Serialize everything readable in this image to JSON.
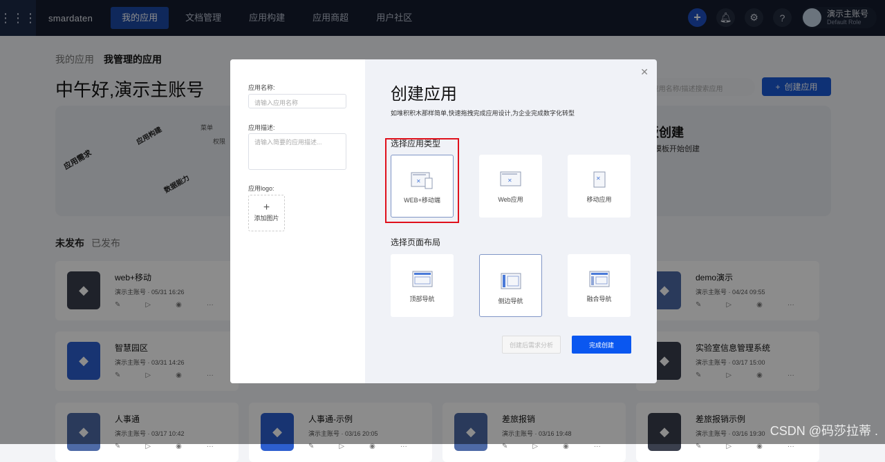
{
  "topbar": {
    "logo": "smardaten",
    "nav": [
      "我的应用",
      "文档管理",
      "应用构建",
      "应用商超",
      "用户社区"
    ],
    "user_name": "演示主账号",
    "user_role": "Default Role"
  },
  "page": {
    "tabs": [
      "我的应用",
      "我管理的应用"
    ],
    "greeting": "中午好,演示主账号",
    "search_placeholder": "入/应用名称/描述搜索应用",
    "create_button": "创建应用",
    "banner_title": "板创建",
    "banner_sub": "有模板开始创建",
    "banner_labels": [
      "应用需求",
      "应用构建",
      "数据能力",
      "菜单",
      "权限"
    ],
    "status_tabs": [
      "未发布",
      "已发布"
    ]
  },
  "cards": [
    {
      "title": "web+移动",
      "owner": "演示主账号",
      "time": "05/31 16:26",
      "color": "#3a3f4d"
    },
    {
      "title": "demo演示",
      "owner": "演示主账号",
      "time": "04/24 09:55",
      "color": "#4e6aa6"
    },
    {
      "title": "智慧园区",
      "owner": "演示主账号",
      "time": "03/31 14:26",
      "color": "#2d5fcf"
    },
    {
      "title": "实验室信息管理系统",
      "owner": "演示主账号",
      "time": "03/17 15:00",
      "color": "#3a3f4d"
    },
    {
      "title": "人事通",
      "owner": "演示主账号",
      "time": "03/17 10:42",
      "color": "#4e6aa6"
    },
    {
      "title": "人事通-示例",
      "owner": "演示主账号",
      "time": "03/16 20:05",
      "color": "#2d5fcf"
    },
    {
      "title": "差旅报销",
      "owner": "演示主账号",
      "time": "03/16 19:48",
      "color": "#4e6aa6"
    },
    {
      "title": "差旅报销示例",
      "owner": "演示主账号",
      "time": "03/16 19:30",
      "color": "#3a3f4d"
    }
  ],
  "modal": {
    "name_label": "应用名称:",
    "name_placeholder": "请输入应用名称",
    "desc_label": "应用描述:",
    "desc_placeholder": "请输入简要的应用描述...",
    "logo_label": "应用logo:",
    "upload_label": "添加图片",
    "title": "创建应用",
    "subtitle": "如堆积积木那样简单,快速拖拽完成应用设计,为企业完成数字化转型",
    "type_section": "选择应用类型",
    "types": [
      "WEB+移动端",
      "Web应用",
      "移动应用"
    ],
    "layout_section": "选择页面布局",
    "layouts": [
      "顶部导航",
      "侧边导航",
      "融合导航"
    ],
    "secondary_button": "创建后需求分析",
    "primary_button": "完成创建"
  },
  "watermark": "CSDN @码莎拉蒂 ."
}
